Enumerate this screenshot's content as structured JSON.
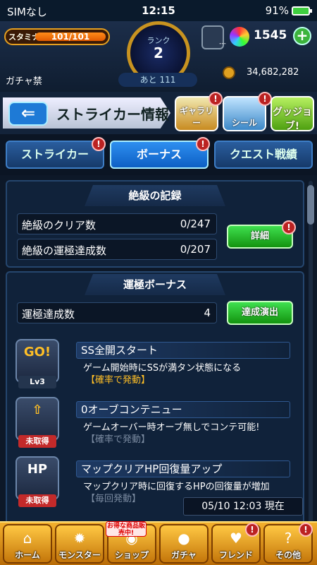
{
  "status_bar": {
    "carrier": "SIMなし",
    "time": "12:15",
    "battery": "91%"
  },
  "hud": {
    "stamina_label": "スタミナ",
    "stamina": "101/101",
    "rank_label": "ランク",
    "rank": "2",
    "rank_remaining": "あと 111",
    "gear_value": "---",
    "orbs": "1545",
    "gacha_ban": "ガチャ禁",
    "coins": "34,682,282"
  },
  "header": {
    "title": "ストライカー情報",
    "gallery": "ギャラリー",
    "seal": "シール",
    "gujo": "グッジョブ!"
  },
  "tabs": [
    {
      "label": "ストライカー"
    },
    {
      "label": "ボーナス"
    },
    {
      "label": "クエスト戦績"
    }
  ],
  "record": {
    "heading": "絶級の記録",
    "rows": [
      {
        "label": "絶級のクリア数",
        "value": "0/247"
      },
      {
        "label": "絶級の運極達成数",
        "value": "0/207"
      }
    ],
    "detail_button": "詳細"
  },
  "bonus": {
    "heading": "運極ボーナス",
    "achieved_label": "運極達成数",
    "achieved_value": "4",
    "effect_button": "達成演出",
    "items": [
      {
        "icon_text": "GO!",
        "tag": "Lv3",
        "title": "SS全開スタート",
        "desc": "ゲーム開始時にSSが満タン状態になる",
        "trigger": "【確率で発動】"
      },
      {
        "icon_text": "⇧",
        "tag": "未取得",
        "title": "0オーブコンテニュー",
        "desc": "ゲームオーバー時オーブ無しでコンテ可能!",
        "trigger": "【確率で発動】"
      },
      {
        "icon_text": "HP",
        "tag": "未取得",
        "title": "マップクリアHP回復量アップ",
        "desc": "マップクリア時に回復するHPの回復量が増加",
        "trigger": "【毎回発動】"
      }
    ],
    "timestamp": "05/10 12:03 現在"
  },
  "bottom_nav": {
    "items": [
      {
        "label": "ホーム",
        "icon": "⌂"
      },
      {
        "label": "モンスター",
        "icon": "✹"
      },
      {
        "label": "ショップ",
        "icon": "◉"
      },
      {
        "label": "ガチャ",
        "icon": "●"
      },
      {
        "label": "フレンド",
        "icon": "♥"
      },
      {
        "label": "その他",
        "icon": "?"
      }
    ],
    "promo": "お得な商品販売中!"
  },
  "colors": {
    "accent": "#2e8ff0",
    "confirm": "#13930f",
    "warning": "#c32a2a"
  }
}
